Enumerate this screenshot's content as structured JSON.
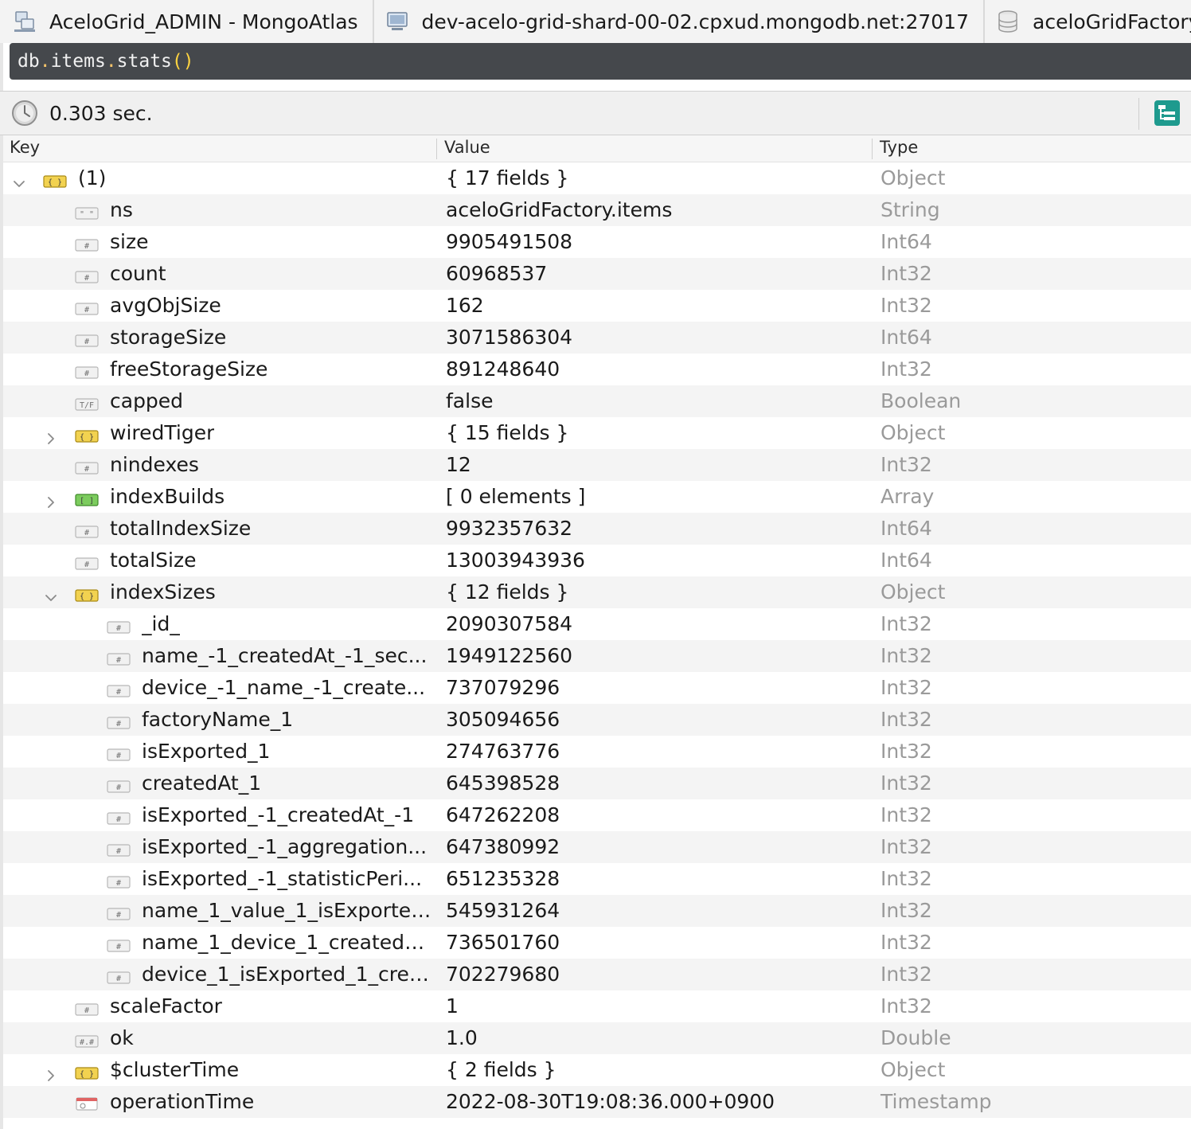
{
  "topbar": {
    "connection": "AceloGrid_ADMIN - MongoAtlas",
    "server": "dev-acelo-grid-shard-00-02.cpxud.mongodb.net:27017",
    "database": "aceloGridFactory"
  },
  "query": {
    "db": "db",
    "dot1": ".",
    "collection": "items",
    "dot2": ".",
    "method": "stats",
    "parens": "()"
  },
  "status": {
    "elapsed": "0.303 sec."
  },
  "columns": {
    "key": "Key",
    "value": "Value",
    "type": "Type"
  },
  "colors": {
    "object_icon": "#e5c23b",
    "array_icon": "#5fba46",
    "type_text": "#9a9a9a",
    "query_bg": "#45484c",
    "paren": "#ffd440"
  },
  "rows": [
    {
      "key": "(1)",
      "value": "{ 17 fields }",
      "type": "Object",
      "depth": 0,
      "icon": "object-icon",
      "expander": "expanded"
    },
    {
      "key": "ns",
      "value": "aceloGridFactory.items",
      "type": "String",
      "depth": 1,
      "icon": "string-icon"
    },
    {
      "key": "size",
      "value": "9905491508",
      "type": "Int64",
      "depth": 1,
      "icon": "number-icon"
    },
    {
      "key": "count",
      "value": "60968537",
      "type": "Int32",
      "depth": 1,
      "icon": "number-icon"
    },
    {
      "key": "avgObjSize",
      "value": "162",
      "type": "Int32",
      "depth": 1,
      "icon": "number-icon"
    },
    {
      "key": "storageSize",
      "value": "3071586304",
      "type": "Int64",
      "depth": 1,
      "icon": "number-icon"
    },
    {
      "key": "freeStorageSize",
      "value": "891248640",
      "type": "Int32",
      "depth": 1,
      "icon": "number-icon"
    },
    {
      "key": "capped",
      "value": "false",
      "type": "Boolean",
      "depth": 1,
      "icon": "boolean-icon"
    },
    {
      "key": "wiredTiger",
      "value": "{ 15 fields }",
      "type": "Object",
      "depth": 1,
      "icon": "object-icon",
      "expander": "collapsed"
    },
    {
      "key": "nindexes",
      "value": "12",
      "type": "Int32",
      "depth": 1,
      "icon": "number-icon"
    },
    {
      "key": "indexBuilds",
      "value": "[ 0 elements ]",
      "type": "Array",
      "depth": 1,
      "icon": "array-icon",
      "expander": "collapsed"
    },
    {
      "key": "totalIndexSize",
      "value": "9932357632",
      "type": "Int64",
      "depth": 1,
      "icon": "number-icon"
    },
    {
      "key": "totalSize",
      "value": "13003943936",
      "type": "Int64",
      "depth": 1,
      "icon": "number-icon"
    },
    {
      "key": "indexSizes",
      "value": "{ 12 fields }",
      "type": "Object",
      "depth": 1,
      "icon": "object-icon",
      "expander": "expanded"
    },
    {
      "key": "_id_",
      "value": "2090307584",
      "type": "Int32",
      "depth": 2,
      "icon": "number-icon"
    },
    {
      "key": "name_-1_createdAt_-1_sec...",
      "value": "1949122560",
      "type": "Int32",
      "depth": 2,
      "icon": "number-icon"
    },
    {
      "key": "device_-1_name_-1_create...",
      "value": "737079296",
      "type": "Int32",
      "depth": 2,
      "icon": "number-icon"
    },
    {
      "key": "factoryName_1",
      "value": "305094656",
      "type": "Int32",
      "depth": 2,
      "icon": "number-icon"
    },
    {
      "key": "isExported_1",
      "value": "274763776",
      "type": "Int32",
      "depth": 2,
      "icon": "number-icon"
    },
    {
      "key": "createdAt_1",
      "value": "645398528",
      "type": "Int32",
      "depth": 2,
      "icon": "number-icon"
    },
    {
      "key": "isExported_-1_createdAt_-1",
      "value": "647262208",
      "type": "Int32",
      "depth": 2,
      "icon": "number-icon"
    },
    {
      "key": "isExported_-1_aggregation...",
      "value": "647380992",
      "type": "Int32",
      "depth": 2,
      "icon": "number-icon"
    },
    {
      "key": "isExported_-1_statisticPeri...",
      "value": "651235328",
      "type": "Int32",
      "depth": 2,
      "icon": "number-icon"
    },
    {
      "key": "name_1_value_1_isExported...",
      "value": "545931264",
      "type": "Int32",
      "depth": 2,
      "icon": "number-icon"
    },
    {
      "key": "name_1_device_1_createdA...",
      "value": "736501760",
      "type": "Int32",
      "depth": 2,
      "icon": "number-icon"
    },
    {
      "key": "device_1_isExported_1_crea...",
      "value": "702279680",
      "type": "Int32",
      "depth": 2,
      "icon": "number-icon"
    },
    {
      "key": "scaleFactor",
      "value": "1",
      "type": "Int32",
      "depth": 1,
      "icon": "number-icon"
    },
    {
      "key": "ok",
      "value": "1.0",
      "type": "Double",
      "depth": 1,
      "icon": "double-icon"
    },
    {
      "key": "$clusterTime",
      "value": "{ 2 fields }",
      "type": "Object",
      "depth": 1,
      "icon": "object-icon",
      "expander": "collapsed"
    },
    {
      "key": "operationTime",
      "value": "2022-08-30T19:08:36.000+0900",
      "type": "Timestamp",
      "depth": 1,
      "icon": "timestamp-icon"
    }
  ]
}
